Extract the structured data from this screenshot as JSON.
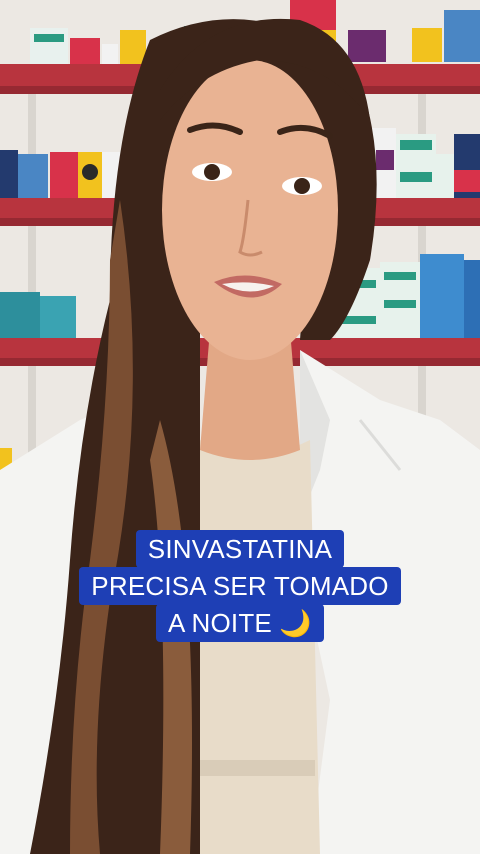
{
  "caption": {
    "lines": [
      "SINVASTATINA",
      "PRECISA SER TOMADO",
      "A NOITE"
    ],
    "emoji": "🌙"
  },
  "colors": {
    "caption_bg": "#1e3fb5",
    "shelf": "#b8343e",
    "wall": "#ede9e4",
    "coat": "#f4f4f2"
  }
}
